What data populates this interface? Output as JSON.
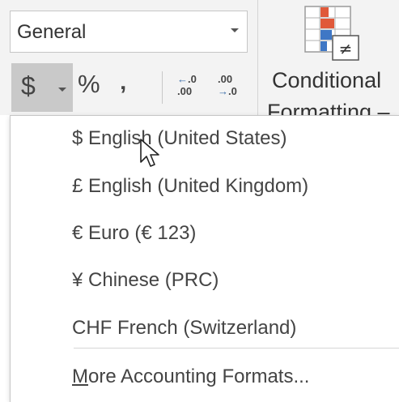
{
  "number_format": {
    "selected_value": "General"
  },
  "toolbar": {
    "accounting_symbol": "$",
    "percent_symbol": "%",
    "comma_symbol": "‚",
    "increase_decimal": {
      "line1": ".0",
      "line2": ".00"
    },
    "decrease_decimal": {
      "line1": ".00",
      "line2": ".0"
    },
    "conditional_formatting_line1": "Conditional",
    "conditional_formatting_line2": "Formatting –"
  },
  "accounting_menu": {
    "items": [
      {
        "label": "$ English (United States)"
      },
      {
        "label": "£ English (United Kingdom)"
      },
      {
        "label": "€ Euro (€ 123)"
      },
      {
        "label": "¥ Chinese (PRC)"
      },
      {
        "label": "CHF French (Switzerland)"
      }
    ],
    "more_formats": {
      "accel": "M",
      "rest": "ore Accounting Formats..."
    }
  },
  "colors": {
    "ribbon_bg": "#f3f3f3",
    "pressed_button": "#c9c9c9",
    "arrow_blue": "#3b6ea8",
    "cf_red": "#e0593a",
    "cf_blue": "#3f77c5"
  }
}
